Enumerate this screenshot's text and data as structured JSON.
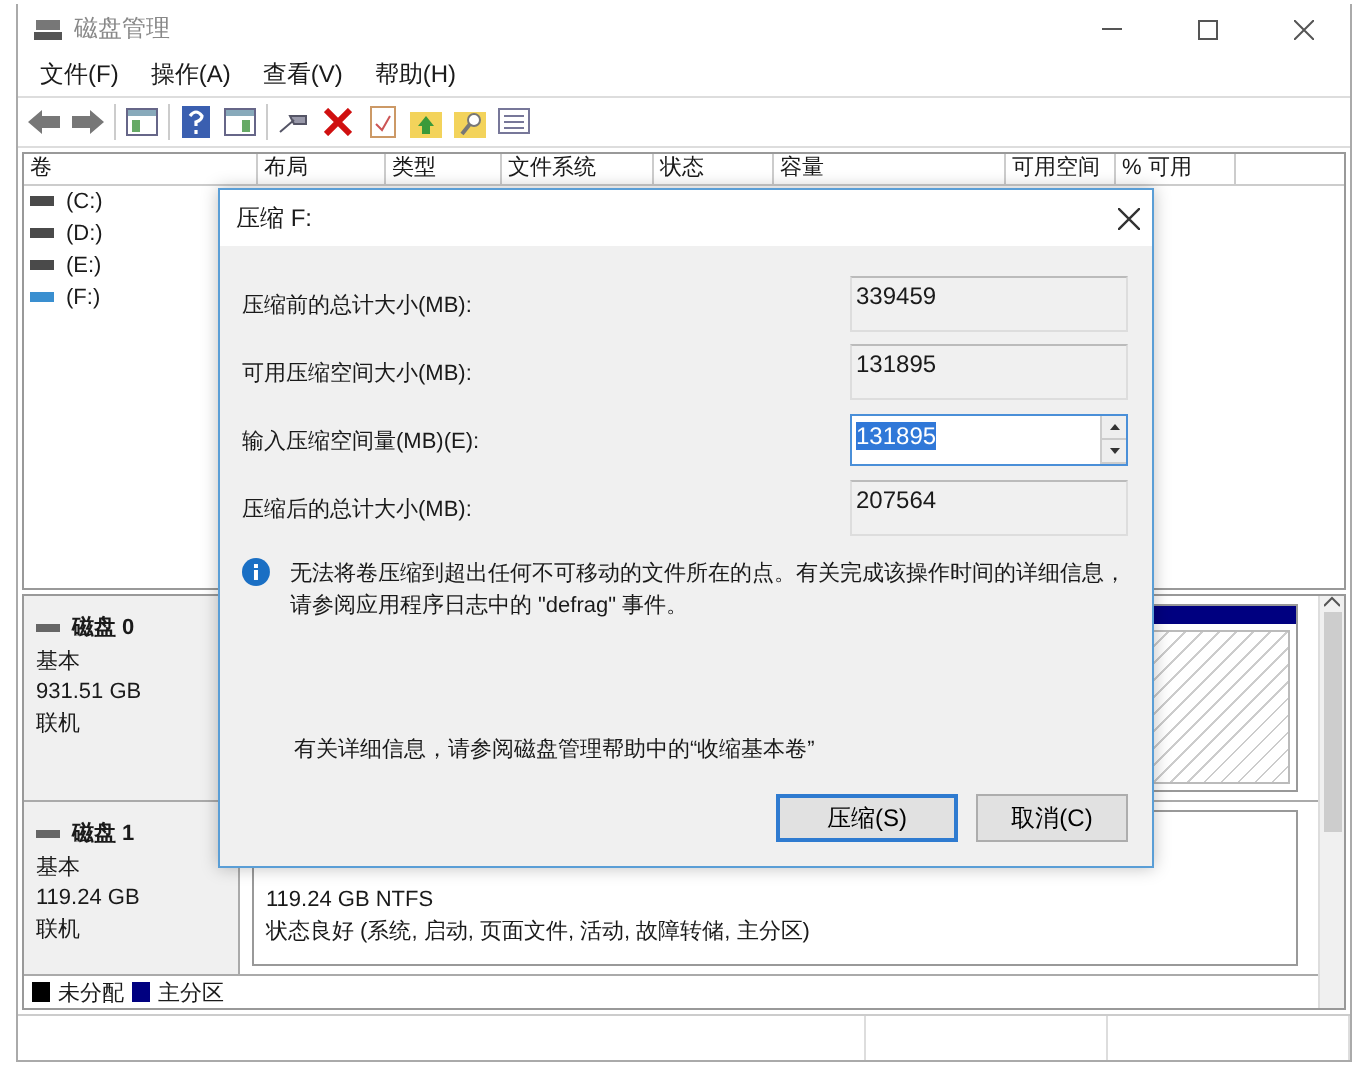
{
  "window": {
    "title": "磁盘管理"
  },
  "menu": [
    "文件(F)",
    "操作(A)",
    "查看(V)",
    "帮助(H)"
  ],
  "volume_table": {
    "columns": [
      "卷",
      "布局",
      "类型",
      "文件系统",
      "状态",
      "容量",
      "可用空间",
      "% 可用"
    ],
    "rows": [
      {
        "volume": "(C:)",
        "color": "#4a4a4a"
      },
      {
        "volume": "(D:)",
        "color": "#4a4a4a"
      },
      {
        "volume": "(E:)",
        "color": "#4a4a4a"
      },
      {
        "volume": "(F:)",
        "color": "#3a8fd0"
      }
    ]
  },
  "disks": [
    {
      "name": "磁盘 0",
      "type": "基本",
      "size": "931.51 GB",
      "status": "联机"
    },
    {
      "name": "磁盘 1",
      "type": "基本",
      "size": "119.24 GB",
      "status": "联机",
      "partition": {
        "size": "119.24 GB NTFS",
        "status": "状态良好 (系统, 启动, 页面文件, 活动, 故障转储, 主分区)"
      }
    }
  ],
  "legend": [
    {
      "label": "未分配",
      "color": "#000000"
    },
    {
      "label": "主分区",
      "color": "#000080"
    }
  ],
  "dialog": {
    "title": "压缩 F:",
    "fields": [
      {
        "label": "压缩前的总计大小(MB):",
        "value": "339459",
        "kind": "readonly"
      },
      {
        "label": "可用压缩空间大小(MB):",
        "value": "131895",
        "kind": "readonly"
      },
      {
        "label": "输入压缩空间量(MB)(E):",
        "value": "131895",
        "kind": "spin"
      },
      {
        "label": "压缩后的总计大小(MB):",
        "value": "207564",
        "kind": "readonly"
      }
    ],
    "info": "无法将卷压缩到超出任何不可移动的文件所在的点。有关完成该操作时间的详细信息，请参阅应用程序日志中的 \"defrag\" 事件。",
    "help": "有关详细信息，请参阅磁盘管理帮助中的“收缩基本卷”",
    "buttons": [
      {
        "label": "压缩(S)",
        "default": true
      },
      {
        "label": "取消(C)",
        "default": false
      }
    ]
  }
}
